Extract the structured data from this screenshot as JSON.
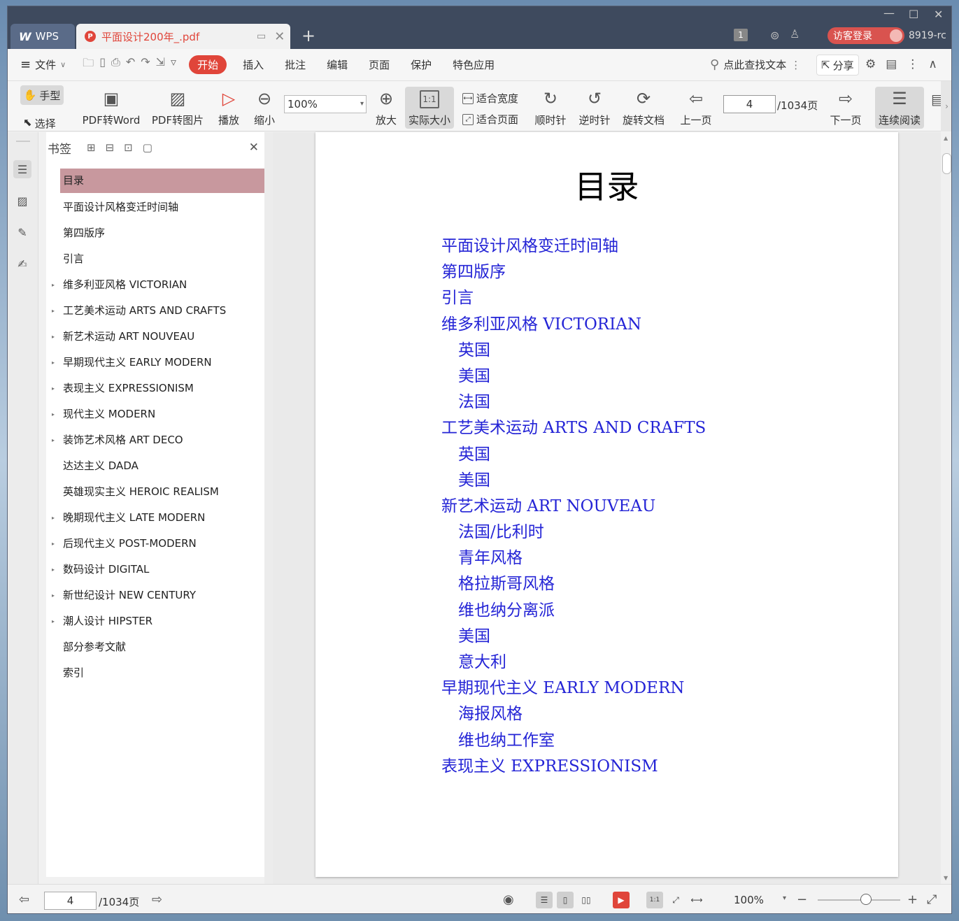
{
  "titlebar": {
    "app_tab": "WPS",
    "app_logo": "W",
    "doc_tab": "平面设计200年_.pdf",
    "badge": "1",
    "login": "访客登录",
    "user": "8919-rc"
  },
  "menubar": {
    "file": "文件",
    "tabs": [
      "开始",
      "插入",
      "批注",
      "编辑",
      "页面",
      "保护",
      "特色应用"
    ],
    "active_tab": "开始",
    "search": "点此查找文本",
    "share": "分享"
  },
  "ribbon": {
    "hand": "手型",
    "select": "选择",
    "pdf_to_word": "PDF转Word",
    "pdf_to_image": "PDF转图片",
    "play": "播放",
    "zoom_out": "缩小",
    "zoom_value": "100%",
    "zoom_in": "放大",
    "actual_size": "实际大小",
    "actual_size_icon": "1:1",
    "fit_width": "适合宽度",
    "fit_page": "适合页面",
    "clockwise": "顺时针",
    "counter_clockwise": "逆时针",
    "rotate_doc": "旋转文档",
    "prev_page": "上一页",
    "page_input": "4",
    "page_total": "/1034页",
    "next_page": "下一页",
    "continuous": "连续阅读"
  },
  "bookmarks": {
    "title": "书签",
    "items": [
      {
        "label": "目录",
        "expandable": false,
        "selected": true
      },
      {
        "label": "平面设计风格变迁时间轴",
        "expandable": false
      },
      {
        "label": "第四版序",
        "expandable": false
      },
      {
        "label": "引言",
        "expandable": false
      },
      {
        "label": "维多利亚风格 VICTORIAN",
        "expandable": true
      },
      {
        "label": "工艺美术运动 ARTS AND CRAFTS",
        "expandable": true
      },
      {
        "label": "新艺术运动 ART NOUVEAU",
        "expandable": true
      },
      {
        "label": "早期现代主义 EARLY MODERN",
        "expandable": true
      },
      {
        "label": "表现主义 EXPRESSIONISM",
        "expandable": true
      },
      {
        "label": "现代主义 MODERN",
        "expandable": true
      },
      {
        "label": "装饰艺术风格 ART DECO",
        "expandable": true
      },
      {
        "label": "达达主义 DADA",
        "expandable": false
      },
      {
        "label": "英雄现实主义 HEROIC REALISM",
        "expandable": false
      },
      {
        "label": "晚期现代主义 LATE MODERN",
        "expandable": true
      },
      {
        "label": "后现代主义 POST-MODERN",
        "expandable": true
      },
      {
        "label": "数码设计 DIGITAL",
        "expandable": true
      },
      {
        "label": "新世纪设计 NEW CENTURY",
        "expandable": true
      },
      {
        "label": "潮人设计 HIPSTER",
        "expandable": true
      },
      {
        "label": "部分参考文献",
        "expandable": false
      },
      {
        "label": "索引",
        "expandable": false
      }
    ]
  },
  "document": {
    "title": "目录",
    "toc": [
      {
        "text": "平面设计风格变迁时间轴",
        "level": 1
      },
      {
        "text": "第四版序",
        "level": 1
      },
      {
        "text": "引言",
        "level": 1
      },
      {
        "text": "维多利亚风格 VICTORIAN",
        "level": 1
      },
      {
        "text": "英国",
        "level": 2
      },
      {
        "text": "美国",
        "level": 2
      },
      {
        "text": "法国",
        "level": 2
      },
      {
        "text": "工艺美术运动 ARTS AND CRAFTS",
        "level": 1
      },
      {
        "text": "英国",
        "level": 2
      },
      {
        "text": "美国",
        "level": 2
      },
      {
        "text": "新艺术运动 ART NOUVEAU",
        "level": 1
      },
      {
        "text": "法国/比利时",
        "level": 2
      },
      {
        "text": "青年风格",
        "level": 2
      },
      {
        "text": "格拉斯哥风格",
        "level": 2
      },
      {
        "text": "维也纳分离派",
        "level": 2
      },
      {
        "text": "美国",
        "level": 2
      },
      {
        "text": "意大利",
        "level": 2
      },
      {
        "text": "早期现代主义 EARLY MODERN",
        "level": 1
      },
      {
        "text": "海报风格",
        "level": 2
      },
      {
        "text": "维也纳工作室",
        "level": 2
      },
      {
        "text": "表现主义 EXPRESSIONISM",
        "level": 1
      }
    ]
  },
  "statusbar": {
    "page_input": "4",
    "page_total": "/1034页",
    "zoom": "100%",
    "zoom_level_percent": 100
  },
  "colors": {
    "accent": "#e0453a",
    "link": "#2424d6",
    "bookmark_selected": "#c8989e",
    "titlebar": "#3e4a5e"
  }
}
